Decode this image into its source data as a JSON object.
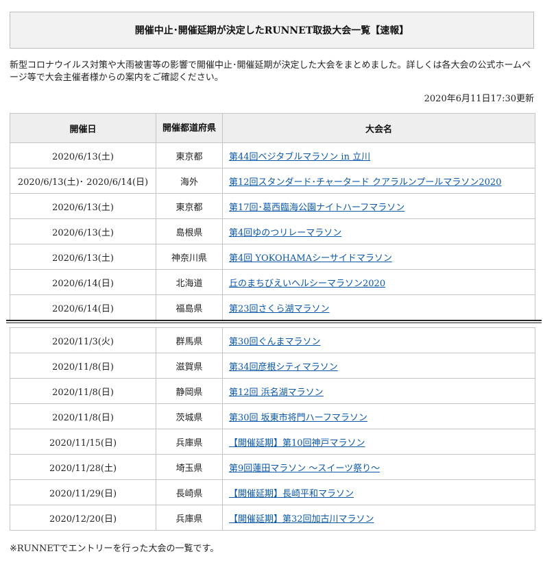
{
  "title": "開催中止･開催延期が決定したRUNNET取扱大会一覧【速報】",
  "intro": "新型コロナウイルス対策や大雨被害等の影響で開催中止･開催延期が決定した大会をまとめました。詳しくは各大会の公式ホームページ等で大会主催者様からの案内をご確認ください。",
  "updated": "2020年6月11日17:30更新",
  "table": {
    "headers": {
      "date": "開催日",
      "pref": "開催都道府県",
      "name": "大会名"
    },
    "rows_top": [
      {
        "date": "2020/6/13(土)",
        "pref": "東京都",
        "name": "第44回ベジタブルマラソン in 立川"
      },
      {
        "date": "2020/6/13(土)･ 2020/6/14(日)",
        "pref": "海外",
        "name": "第12回スタンダード･チャータード クアラルンプールマラソン2020"
      },
      {
        "date": "2020/6/13(土)",
        "pref": "東京都",
        "name": "第17回･葛西臨海公園ナイトハーフマラソン"
      },
      {
        "date": "2020/6/13(土)",
        "pref": "島根県",
        "name": "第4回ゆのつリレーマラソン"
      },
      {
        "date": "2020/6/13(土)",
        "pref": "神奈川県",
        "name": "第4回 YOKOHAMAシーサイドマラソン"
      },
      {
        "date": "2020/6/14(日)",
        "pref": "北海道",
        "name": "丘のまちびえいヘルシーマラソン2020"
      },
      {
        "date": "2020/6/14(日)",
        "pref": "福島県",
        "name": "第23回さくら湖マラソン"
      }
    ],
    "rows_bottom": [
      {
        "date": "2020/11/3(火)",
        "pref": "群馬県",
        "name": "第30回ぐんまマラソン"
      },
      {
        "date": "2020/11/8(日)",
        "pref": "滋賀県",
        "name": "第34回彦根シティマラソン"
      },
      {
        "date": "2020/11/8(日)",
        "pref": "静岡県",
        "name": "第12回 浜名湖マラソン"
      },
      {
        "date": "2020/11/8(日)",
        "pref": "茨城県",
        "name": "第30回 坂東市将門ハーフマラソン"
      },
      {
        "date": "2020/11/15(日)",
        "pref": "兵庫県",
        "name": "【開催延期】第10回神戸マラソン"
      },
      {
        "date": "2020/11/28(土)",
        "pref": "埼玉県",
        "name": "第9回蓮田マラソン ～スイーツ祭り～"
      },
      {
        "date": "2020/11/29(日)",
        "pref": "長崎県",
        "name": "【開催延期】長崎平和マラソン"
      },
      {
        "date": "2020/12/20(日)",
        "pref": "兵庫県",
        "name": "【開催延期】第32回加古川マラソン"
      }
    ]
  },
  "footnote": "※RUNNETでエントリーを行った大会の一覧です。",
  "colors": {
    "link": "#0a57a8",
    "header_bg": "#eeeeee",
    "title_bg": "#f2f2f2",
    "border": "#c4c4c4"
  }
}
